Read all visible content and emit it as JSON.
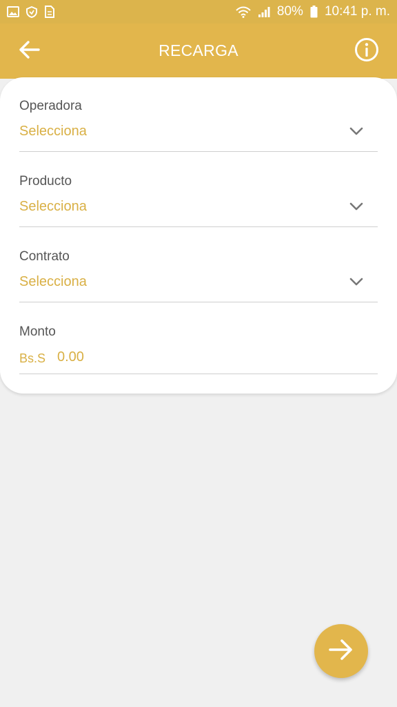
{
  "status_bar": {
    "battery": "80%",
    "time": "10:41 p. m."
  },
  "app_bar": {
    "title": "RECARGA"
  },
  "form": {
    "operadora": {
      "label": "Operadora",
      "value": "Selecciona"
    },
    "producto": {
      "label": "Producto",
      "value": "Selecciona"
    },
    "contrato": {
      "label": "Contrato",
      "value": "Selecciona"
    },
    "monto": {
      "label": "Monto",
      "currency": "Bs.S",
      "value": "0.00"
    }
  },
  "colors": {
    "accent": "#e2b64c",
    "status_bar": "#dcb44c",
    "value_text": "#d9b045",
    "label_text": "#555555",
    "background": "#f0f0f0"
  },
  "icons": {
    "back": "arrow-left-icon",
    "info": "info-circle-icon",
    "dropdown": "chevron-down-icon",
    "next": "arrow-right-icon"
  }
}
